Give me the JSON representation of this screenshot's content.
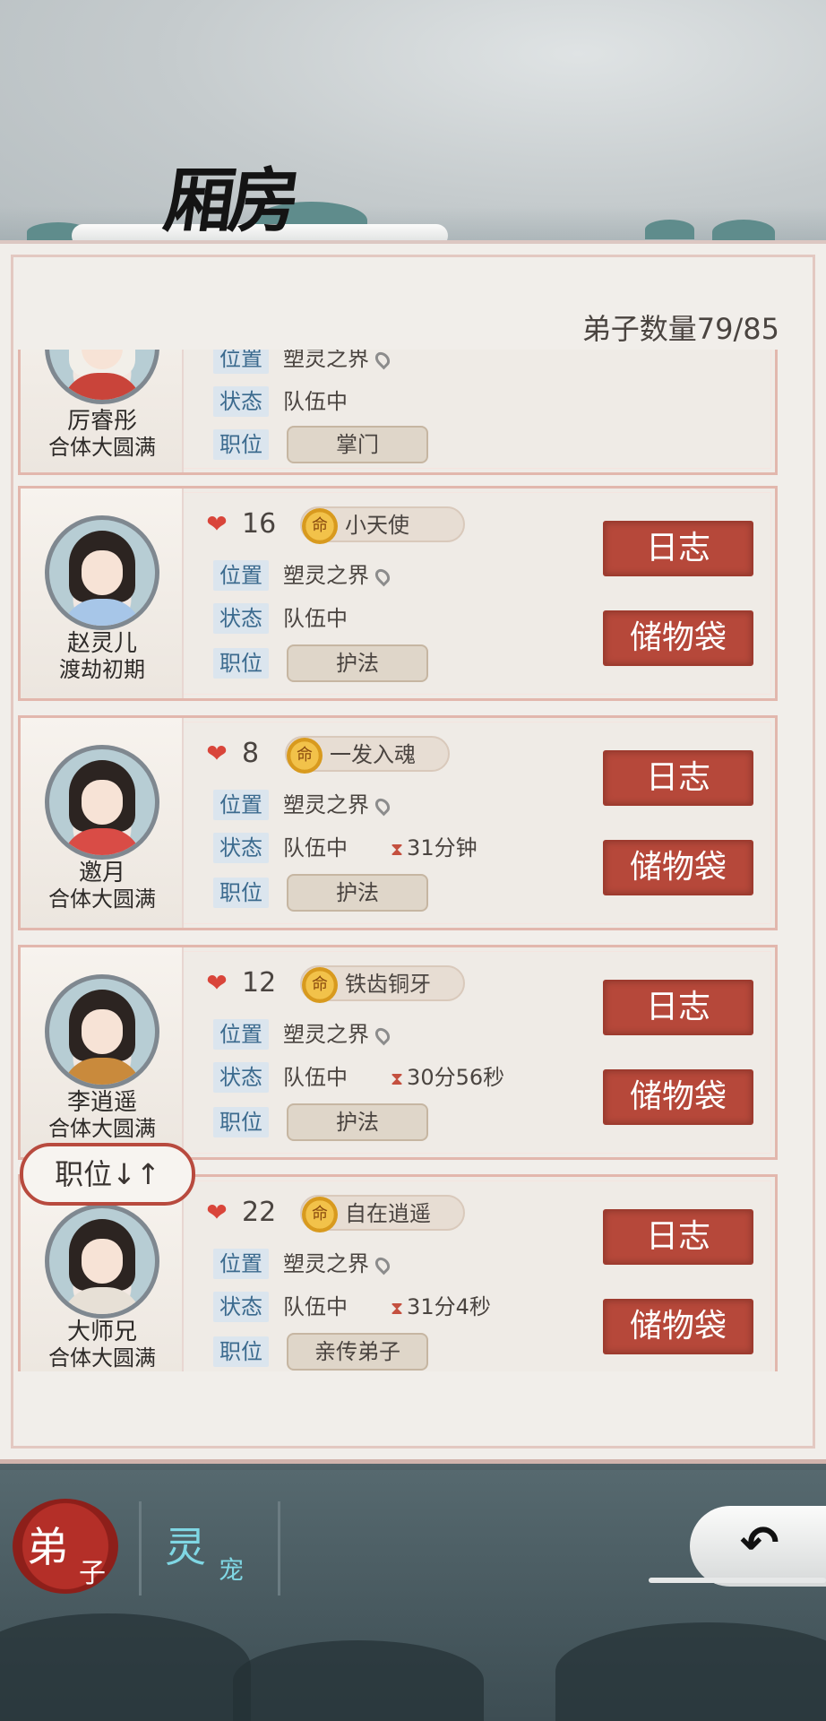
{
  "header": {
    "title": "厢房"
  },
  "disciple_count": "弟子数量79/85",
  "labels": {
    "location": "位置",
    "status": "状态",
    "position": "职位"
  },
  "buttons": {
    "log": "日志",
    "bag": "储物袋",
    "sort": "职位↓↑"
  },
  "disciples": [
    {
      "name": "厉睿彤",
      "realm": "合体大圆满",
      "location": "塑灵之界",
      "status": "队伍中",
      "role": "掌门"
    },
    {
      "name": "赵灵儿",
      "realm": "渡劫初期",
      "level": "16",
      "trait": "小天使",
      "location": "塑灵之界",
      "status": "队伍中",
      "timer": "",
      "role": "护法"
    },
    {
      "name": "邀月",
      "realm": "合体大圆满",
      "level": "8",
      "trait": "一发入魂",
      "location": "塑灵之界",
      "status": "队伍中",
      "timer": "31分钟",
      "role": "护法"
    },
    {
      "name": "李逍遥",
      "realm": "合体大圆满",
      "level": "12",
      "trait": "铁齿铜牙",
      "location": "塑灵之界",
      "status": "队伍中",
      "timer": "30分56秒",
      "role": "护法"
    },
    {
      "name": "大师兄",
      "realm": "合体大圆满",
      "level": "22",
      "trait": "自在逍遥",
      "location": "塑灵之界",
      "status": "队伍中",
      "timer": "31分4秒",
      "role": "亲传弟子"
    }
  ],
  "bottom_tabs": {
    "disciple": {
      "big": "弟",
      "small": "子"
    },
    "pet": {
      "big": "灵",
      "small": "宠"
    }
  },
  "colors": {
    "accent_red": "#b6483a",
    "tag_blue": "#3b6a8e",
    "panel": "#f1eeea"
  }
}
